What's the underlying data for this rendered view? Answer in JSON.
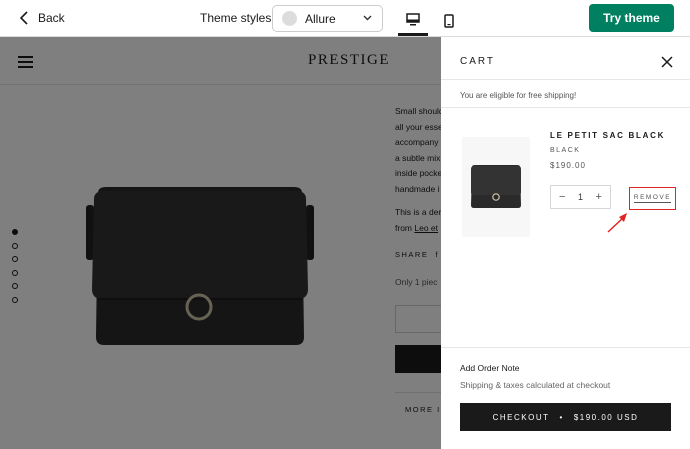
{
  "topbar": {
    "back_label": "Back",
    "theme_styles_label": "Theme styles",
    "theme_selected": "Allure",
    "try_theme_label": "Try theme",
    "accent_color": "#008060",
    "icons": [
      "chevron-left-icon",
      "chevron-down-icon",
      "desktop-icon",
      "mobile-icon"
    ]
  },
  "store": {
    "logo": "PRESTIGE",
    "description_lines": [
      "Small should",
      "all your esse",
      "accompany",
      "a subtle mix",
      "inside pocke",
      "handmade i"
    ],
    "designer_line": "This is a der",
    "designer_from": "from",
    "designer_link": "Leo et",
    "share_label": "SHARE",
    "stock_text": "Only 1 piec",
    "more_label": "MORE I"
  },
  "cart": {
    "title": "CART",
    "free_shipping": "You are eligible for free shipping!",
    "item": {
      "name": "LE PETIT SAC BLACK",
      "variant": "BLACK",
      "price": "$190.00",
      "quantity": "1",
      "minus": "−",
      "plus": "+",
      "remove_label": "REMOVE"
    },
    "order_note": "Add Order Note",
    "taxes_note": "Shipping & taxes calculated at checkout",
    "checkout_label": "CHECKOUT",
    "checkout_sep": "•",
    "checkout_total": "$190.00 USD",
    "highlight_color": "#e02424"
  }
}
